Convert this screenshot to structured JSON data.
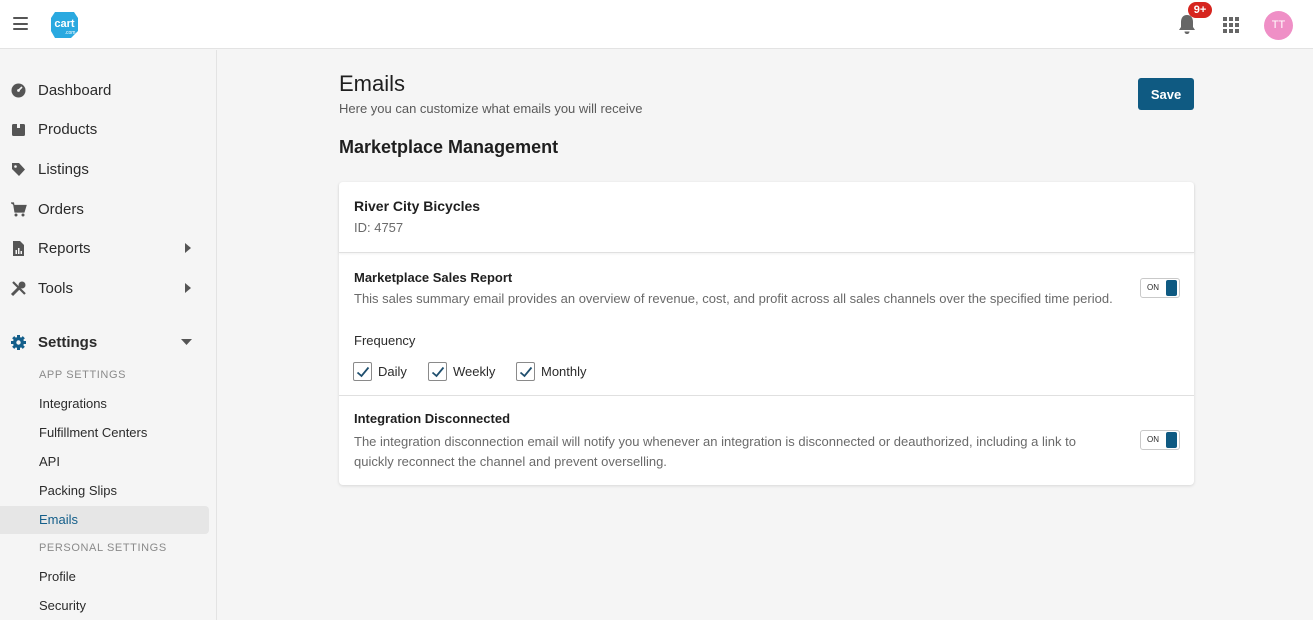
{
  "header": {
    "logo_text": "cart",
    "logo_sub": ".com",
    "notification_badge": "9+",
    "avatar_initials": "TT"
  },
  "sidebar": {
    "nav": [
      {
        "label": "Dashboard",
        "icon": "dashboard-icon"
      },
      {
        "label": "Products",
        "icon": "box-icon"
      },
      {
        "label": "Listings",
        "icon": "tag-icon"
      },
      {
        "label": "Orders",
        "icon": "cart-icon"
      },
      {
        "label": "Reports",
        "icon": "report-icon"
      },
      {
        "label": "Tools",
        "icon": "tools-icon"
      },
      {
        "label": "Settings",
        "icon": "gear-icon"
      }
    ],
    "app_settings_header": "APP SETTINGS",
    "app_settings": [
      "Integrations",
      "Fulfillment Centers",
      "API",
      "Packing Slips",
      "Emails"
    ],
    "personal_settings_header": "PERSONAL SETTINGS",
    "personal_settings": [
      "Profile",
      "Security"
    ]
  },
  "main": {
    "title": "Emails",
    "subtitle": "Here you can customize what emails you will receive",
    "save_label": "Save",
    "section_title": "Marketplace Management",
    "card": {
      "name": "River City Bicycles",
      "id_text": "ID: 4757",
      "sales_report": {
        "title": "Marketplace Sales Report",
        "description": "This sales summary email provides an overview of revenue, cost, and profit across all sales channels over the specified time period.",
        "toggle_label": "ON",
        "frequency_label": "Frequency",
        "options": [
          "Daily",
          "Weekly",
          "Monthly"
        ]
      },
      "disconnected": {
        "title": "Integration Disconnected",
        "description_line1": "The integration disconnection email will notify you whenever an integration is disconnected or deauthorized, including a link to",
        "description_line2": "quickly reconnect the channel and prevent overselling.",
        "toggle_label": "ON"
      }
    }
  },
  "colors": {
    "accent": "#0f5a82",
    "badge": "#d6251f",
    "avatar": "#ef8fc6",
    "logo": "#2aa9e0"
  }
}
